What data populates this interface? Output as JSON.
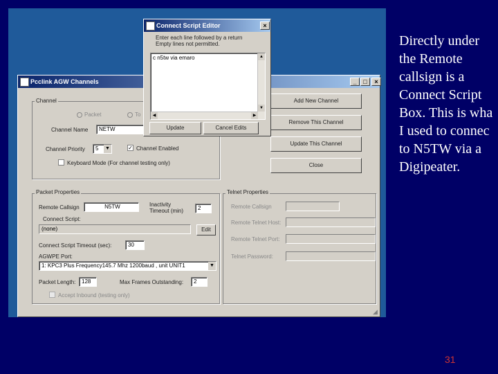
{
  "slide": {
    "text_lines": [
      "Directly under",
      "the Remote",
      "callsign is a",
      "Connect Script",
      "Box. This is wha",
      "I used to connec",
      "to N5TW via a",
      "Digipeater."
    ],
    "page_number": "31"
  },
  "main_window": {
    "title": "Pcclink AGW Channels",
    "channel_group": {
      "title": "Channel",
      "radio_packet": "Packet",
      "radio_telnet": "To",
      "channel_name_label": "Channel Name",
      "channel_name_value": "NETW",
      "channel_priority_label": "Channel Priority",
      "channel_priority_value": "5",
      "channel_enabled_label": "Channel Enabled",
      "channel_enabled_checked": "✓",
      "keyboard_mode_label": "Keyboard Mode (For channel testing only)"
    },
    "buttons": {
      "add": "Add New Channel",
      "remove": "Remove This Channel",
      "update": "Update This Channel",
      "close": "Close"
    },
    "packet_group": {
      "title": "Packet Properties",
      "remote_callsign_label": "Remote Callsign",
      "remote_callsign_value": "N5TW",
      "inactivity_label_1": "Inactivity",
      "inactivity_label_2": "Timeout (min)",
      "inactivity_value": "2",
      "connect_script_label": "Connect Script:",
      "connect_script_value": "(none)",
      "edit_button": "Edit",
      "connect_timeout_label": "Connect Script Timeout (sec):",
      "connect_timeout_value": "30",
      "agwpe_port_label": "AGWPE Port:",
      "agwpe_port_value": "1: KPC3 Plus Frequency145.7 Mhz 1200baud  , unit UNIT1",
      "packet_length_label": "Packet Length:",
      "packet_length_value": "128",
      "max_frames_label": "Max Frames Outstanding:",
      "max_frames_value": "2",
      "accept_inbound_label": "Accept Inbound (testing only)"
    },
    "telnet_group": {
      "title": "Telnet Properties",
      "remote_callsign_label": "Remote Callsign",
      "remote_host_label": "Remote Telnet Host:",
      "remote_port_label": "Remote Telnet Port:",
      "password_label": "Telnet Password:"
    }
  },
  "dialog": {
    "title": "Connect Script Editor",
    "instructions_1": "Enter each line followed by a return",
    "instructions_2": "Empty lines not permitted.",
    "script_text": "c n5tw via emaro",
    "update_button": "Update",
    "cancel_button": "Cancel Edits"
  }
}
